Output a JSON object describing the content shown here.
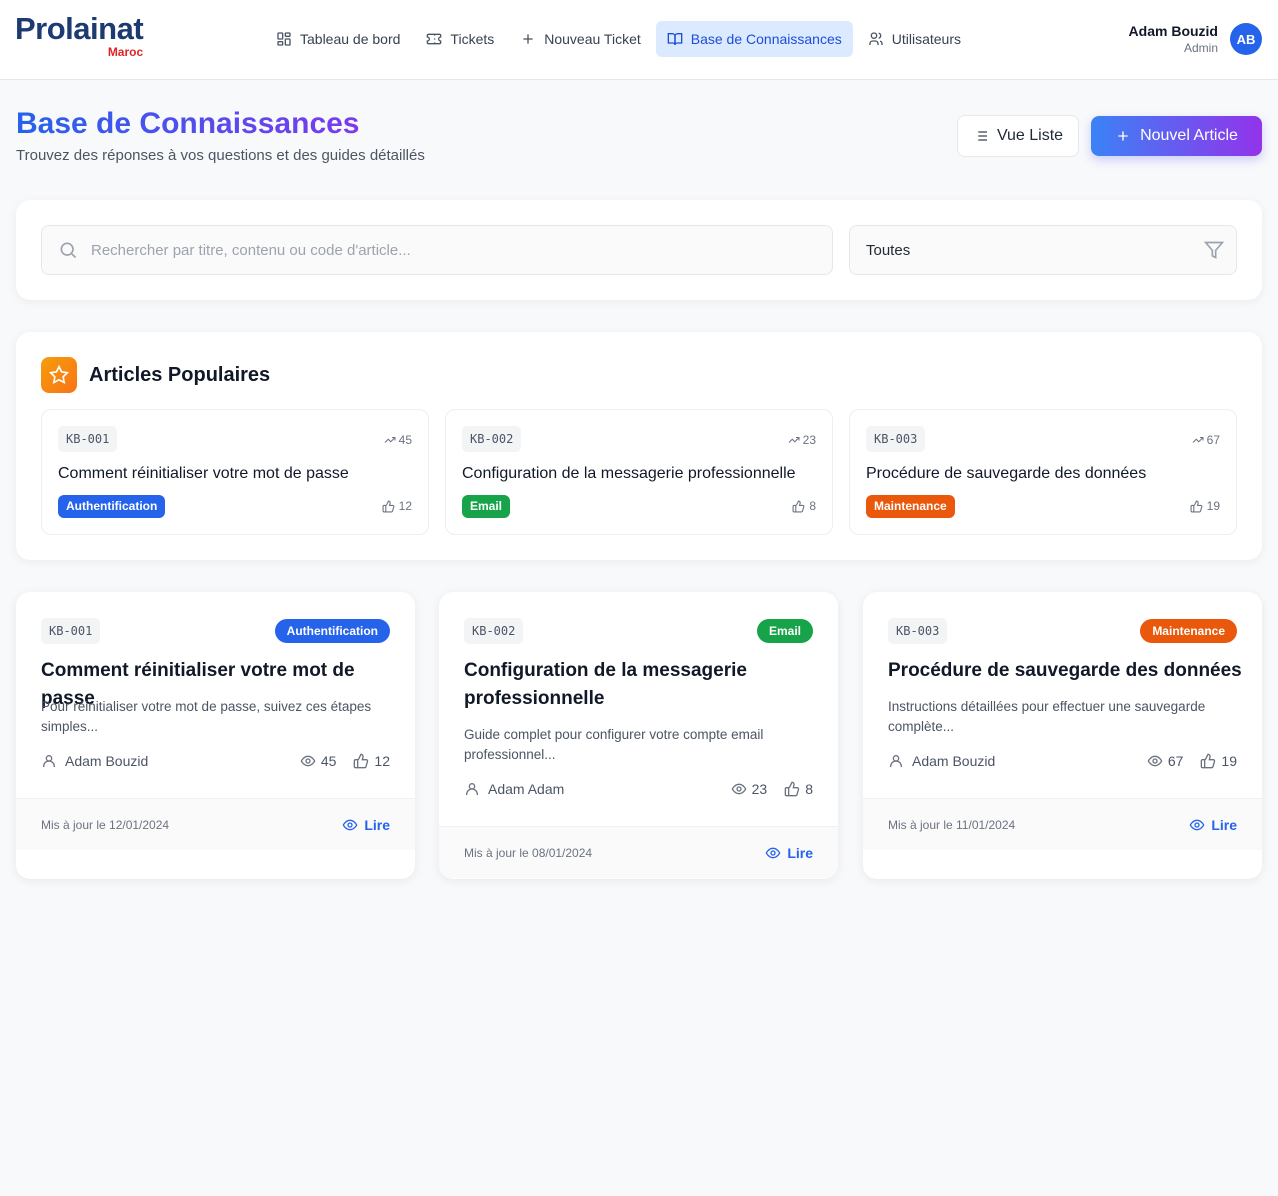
{
  "app": {
    "logo": "Prolainat",
    "logo_sub": "Maroc"
  },
  "nav": [
    {
      "label": "Tableau de bord",
      "icon": "grid-icon"
    },
    {
      "label": "Tickets",
      "icon": "ticket-icon"
    },
    {
      "label": "Nouveau Ticket",
      "icon": "plus-icon"
    },
    {
      "label": "Base de Connaissances",
      "icon": "book-icon",
      "active": true
    },
    {
      "label": "Utilisateurs",
      "icon": "users-icon"
    }
  ],
  "user": {
    "name": "Adam Bouzid",
    "role": "Admin",
    "initials": "AB"
  },
  "page": {
    "title": "Base de Connaissances",
    "subtitle": "Trouvez des réponses à vos questions et des guides détaillés",
    "list_view_label": "Vue Liste",
    "new_article_label": "Nouvel Article"
  },
  "search": {
    "placeholder": "Rechercher par titre, contenu ou code d'article...",
    "value": "",
    "filter_value": "Toutes"
  },
  "popular": {
    "title": "Articles Populaires",
    "items": [
      {
        "code": "KB-001",
        "trend": "45",
        "title": "Comment réinitialiser votre mot de passe",
        "category": "Authentification",
        "likes": "12"
      },
      {
        "code": "KB-002",
        "trend": "23",
        "title": "Configuration de la messagerie professionnelle",
        "category": "Email",
        "likes": "8"
      },
      {
        "code": "KB-003",
        "trend": "67",
        "title": "Procédure de sauvegarde des données",
        "category": "Maintenance",
        "likes": "19"
      }
    ]
  },
  "articles": [
    {
      "code": "KB-001",
      "category": "Authentification",
      "title": "Comment réinitialiser votre mot de passe",
      "excerpt": "Pour réinitialiser votre mot de passe, suivez ces étapes simples...",
      "author": "Adam Bouzid",
      "views": "45",
      "likes": "12",
      "updated": "Mis à jour le 12/01/2024",
      "read_label": "Lire"
    },
    {
      "code": "KB-002",
      "category": "Email",
      "title": "Configuration de la messagerie professionnelle",
      "excerpt": "Guide complet pour configurer votre compte email professionnel...",
      "author": "Adam Adam",
      "views": "23",
      "likes": "8",
      "updated": "Mis à jour le 08/01/2024",
      "read_label": "Lire"
    },
    {
      "code": "KB-003",
      "category": "Maintenance",
      "title": "Procédure de sauvegarde des données",
      "excerpt": "Instructions détaillées pour effectuer une sauvegarde complète...",
      "author": "Adam Bouzid",
      "views": "67",
      "likes": "19",
      "updated": "Mis à jour le 11/01/2024",
      "read_label": "Lire"
    }
  ],
  "colors": {
    "brand_blue": "#1e3a72",
    "accent": "#2563eb",
    "auth": "#2563eb",
    "email": "#16a34a",
    "maintenance": "#ea580c"
  }
}
